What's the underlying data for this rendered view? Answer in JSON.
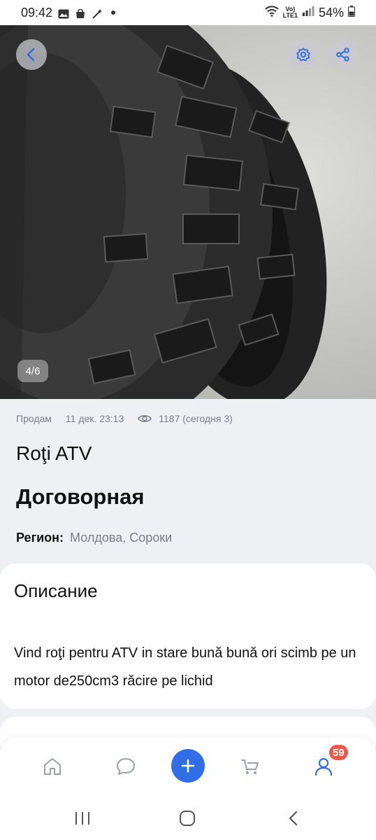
{
  "status_bar": {
    "time": "09:42",
    "lte_top": "Vo)",
    "lte_bottom": "LTE1",
    "battery": "54%"
  },
  "gallery": {
    "counter": "4/6"
  },
  "listing": {
    "type": "Продам",
    "date": "11 дек. 23:13",
    "views": "1187 (сегодня 3)",
    "title": "Roţi ATV",
    "price": "Договорная",
    "region_label": "Регион:",
    "region_value": "Молдова, Сороки"
  },
  "description": {
    "title": "Описание",
    "text": "Vind roţi pentru ATV in stare bună bună ori scimb pe un motor de250cm3 răcire pe lichid"
  },
  "tabbar": {
    "profile_badge": "59"
  },
  "colors": {
    "accent": "#2f6ee6",
    "badge": "#f0574b",
    "muted_text": "#7a7f88"
  }
}
